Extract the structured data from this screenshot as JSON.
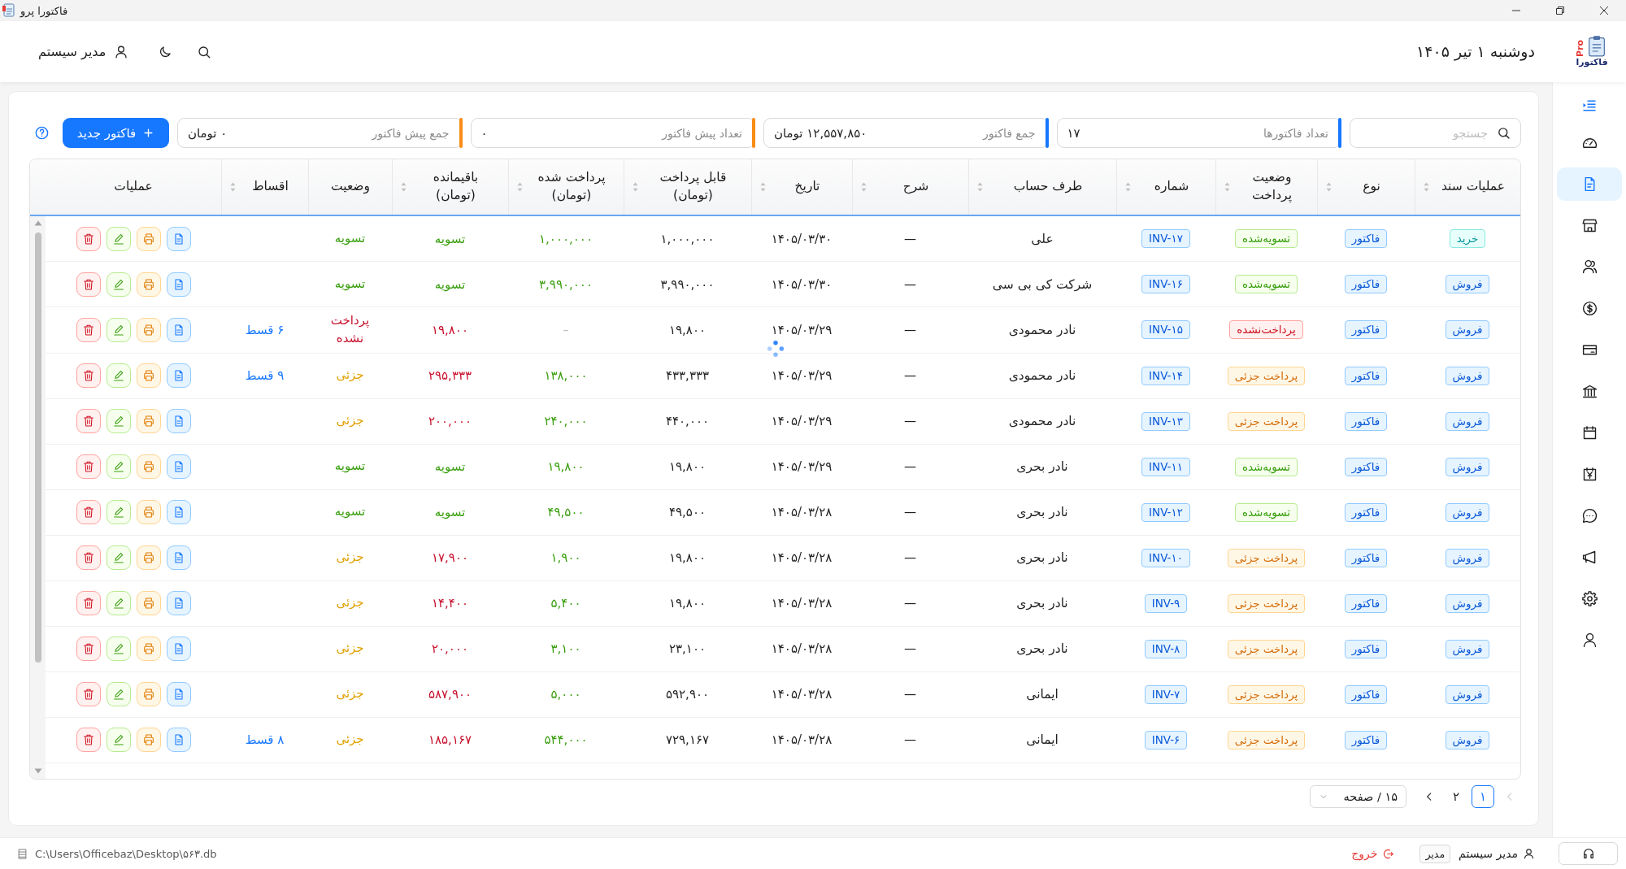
{
  "window": {
    "title": "فاکتورا پرو"
  },
  "header": {
    "logo": {
      "badge": "Pro",
      "name": "فاکتورا"
    },
    "date": "دوشنبه ۱ تیر ۱۴۰۵",
    "user": "مدیر سیستم"
  },
  "sidebar": {
    "items": [
      {
        "kind": "gauge",
        "selected": false
      },
      {
        "kind": "document",
        "selected": true
      },
      {
        "kind": "shop",
        "selected": false
      },
      {
        "kind": "people",
        "selected": false
      },
      {
        "kind": "coin",
        "selected": false
      },
      {
        "kind": "card",
        "selected": false
      },
      {
        "kind": "bank",
        "selected": false
      },
      {
        "kind": "calendar",
        "selected": false
      },
      {
        "kind": "yen",
        "selected": false
      },
      {
        "kind": "chat",
        "selected": false
      },
      {
        "kind": "megaphone",
        "selected": false
      },
      {
        "kind": "gear",
        "selected": false
      },
      {
        "kind": "user",
        "selected": false
      }
    ]
  },
  "toolbar": {
    "search": {
      "placeholder": "جستجو"
    },
    "stats": [
      {
        "label": "تعداد فاکتورها",
        "value": "۱۷",
        "color": "#1677ff"
      },
      {
        "label": "جمع فاکتور",
        "value": "۱۲,۵۵۷,۸۵۰ تومان",
        "color": "#1677ff"
      },
      {
        "label": "تعداد پیش فاکتور",
        "value": "۰",
        "color": "#fa8c16"
      },
      {
        "label": "جمع پیش فاکتور",
        "value": "۰ تومان",
        "color": "#fa8c16"
      }
    ],
    "new_button": "فاکتور جدید"
  },
  "table": {
    "loading": true,
    "columns": [
      {
        "label": "عملیات سند",
        "sortable": true
      },
      {
        "label": "نوع",
        "sortable": true
      },
      {
        "label": "وضعیت پرداخت",
        "sortable": true
      },
      {
        "label": "شماره",
        "sortable": true
      },
      {
        "label": "طرف حساب",
        "sortable": true
      },
      {
        "label": "شرح",
        "sortable": true
      },
      {
        "label": "تاریخ",
        "sortable": true
      },
      {
        "label": "قابل پرداخت (تومان)",
        "sortable": true
      },
      {
        "label": "پرداخت شده (تومان)",
        "sortable": true
      },
      {
        "label": "باقیمانده (تومان)",
        "sortable": true
      },
      {
        "label": "وضعیت",
        "sortable": false
      },
      {
        "label": "اقساط",
        "sortable": true
      },
      {
        "label": "عملیات",
        "sortable": false
      }
    ],
    "rows": [
      {
        "operation": {
          "text": "خرید",
          "kind": "purchase"
        },
        "type": "فاکتور",
        "payment": {
          "text": "تسویه‌شده",
          "kind": "paid"
        },
        "number": "INV-۱۷",
        "party": "علی",
        "description": "—",
        "date": "۱۴۰۵/۰۳/۳۰",
        "payable": "۱,۰۰۰,۰۰۰",
        "paid": {
          "text": "۱,۰۰۰,۰۰۰",
          "kind": "paid"
        },
        "remaining": {
          "text": "تسویه",
          "kind": "paid"
        },
        "status": {
          "text": "تسویه",
          "kind": "paid"
        }
      },
      {
        "operation": {
          "text": "فروش",
          "kind": "sale"
        },
        "type": "فاکتور",
        "payment": {
          "text": "تسویه‌شده",
          "kind": "paid"
        },
        "number": "INV-۱۶",
        "party": "شرکت کی بی سی",
        "description": "—",
        "date": "۱۴۰۵/۰۳/۳۰",
        "payable": "۳,۹۹۰,۰۰۰",
        "paid": {
          "text": "۳,۹۹۰,۰۰۰",
          "kind": "paid"
        },
        "remaining": {
          "text": "تسویه",
          "kind": "paid"
        },
        "status": {
          "text": "تسویه",
          "kind": "paid"
        }
      },
      {
        "operation": {
          "text": "فروش",
          "kind": "sale"
        },
        "type": "فاکتور",
        "payment": {
          "text": "پرداخت‌نشده",
          "kind": "unpaid"
        },
        "number": "INV-۱۵",
        "party": "نادر محمودی",
        "description": "—",
        "date": "۱۴۰۵/۰۳/۲۹",
        "payable": "۱۹,۸۰۰",
        "paid": {
          "text": "–",
          "kind": "none"
        },
        "remaining": {
          "text": "۱۹,۸۰۰",
          "kind": "unpaid"
        },
        "status": {
          "text": "پرداخت نشده",
          "kind": "unpaid"
        },
        "installments": "۶ قسط"
      },
      {
        "operation": {
          "text": "فروش",
          "kind": "sale"
        },
        "type": "فاکتور",
        "payment": {
          "text": "پرداخت جزئی",
          "kind": "partial"
        },
        "number": "INV-۱۴",
        "party": "نادر محمودی",
        "description": "—",
        "date": "۱۴۰۵/۰۳/۲۹",
        "payable": "۴۳۳,۳۳۳",
        "paid": {
          "text": "۱۳۸,۰۰۰",
          "kind": "paid"
        },
        "remaining": {
          "text": "۲۹۵,۳۳۳",
          "kind": "unpaid"
        },
        "status": {
          "text": "جزئی",
          "kind": "partial"
        },
        "installments": "۹ قسط"
      },
      {
        "operation": {
          "text": "فروش",
          "kind": "sale"
        },
        "type": "فاکتور",
        "payment": {
          "text": "پرداخت جزئی",
          "kind": "partial"
        },
        "number": "INV-۱۳",
        "party": "نادر محمودی",
        "description": "—",
        "date": "۱۴۰۵/۰۳/۲۹",
        "payable": "۴۴۰,۰۰۰",
        "paid": {
          "text": "۲۴۰,۰۰۰",
          "kind": "paid"
        },
        "remaining": {
          "text": "۲۰۰,۰۰۰",
          "kind": "unpaid"
        },
        "status": {
          "text": "جزئی",
          "kind": "partial"
        }
      },
      {
        "operation": {
          "text": "فروش",
          "kind": "sale"
        },
        "type": "فاکتور",
        "payment": {
          "text": "تسویه‌شده",
          "kind": "paid"
        },
        "number": "INV-۱۱",
        "party": "نادر بحری",
        "description": "—",
        "date": "۱۴۰۵/۰۳/۲۹",
        "payable": "۱۹,۸۰۰",
        "paid": {
          "text": "۱۹,۸۰۰",
          "kind": "paid"
        },
        "remaining": {
          "text": "تسویه",
          "kind": "paid"
        },
        "status": {
          "text": "تسویه",
          "kind": "paid"
        }
      },
      {
        "operation": {
          "text": "فروش",
          "kind": "sale"
        },
        "type": "فاکتور",
        "payment": {
          "text": "تسویه‌شده",
          "kind": "paid"
        },
        "number": "INV-۱۲",
        "party": "نادر بحری",
        "description": "—",
        "date": "۱۴۰۵/۰۳/۲۸",
        "payable": "۴۹,۵۰۰",
        "paid": {
          "text": "۴۹,۵۰۰",
          "kind": "paid"
        },
        "remaining": {
          "text": "تسویه",
          "kind": "paid"
        },
        "status": {
          "text": "تسویه",
          "kind": "paid"
        }
      },
      {
        "operation": {
          "text": "فروش",
          "kind": "sale"
        },
        "type": "فاکتور",
        "payment": {
          "text": "پرداخت جزئی",
          "kind": "partial"
        },
        "number": "INV-۱۰",
        "party": "نادر بحری",
        "description": "—",
        "date": "۱۴۰۵/۰۳/۲۸",
        "payable": "۱۹,۸۰۰",
        "paid": {
          "text": "۱,۹۰۰",
          "kind": "paid"
        },
        "remaining": {
          "text": "۱۷,۹۰۰",
          "kind": "unpaid"
        },
        "status": {
          "text": "جزئی",
          "kind": "partial"
        }
      },
      {
        "operation": {
          "text": "فروش",
          "kind": "sale"
        },
        "type": "فاکتور",
        "payment": {
          "text": "پرداخت جزئی",
          "kind": "partial"
        },
        "number": "INV-۹",
        "party": "نادر بحری",
        "description": "—",
        "date": "۱۴۰۵/۰۳/۲۸",
        "payable": "۱۹,۸۰۰",
        "paid": {
          "text": "۵,۴۰۰",
          "kind": "paid"
        },
        "remaining": {
          "text": "۱۴,۴۰۰",
          "kind": "unpaid"
        },
        "status": {
          "text": "جزئی",
          "kind": "partial"
        }
      },
      {
        "operation": {
          "text": "فروش",
          "kind": "sale"
        },
        "type": "فاکتور",
        "payment": {
          "text": "پرداخت جزئی",
          "kind": "partial"
        },
        "number": "INV-۸",
        "party": "نادر بحری",
        "description": "—",
        "date": "۱۴۰۵/۰۳/۲۸",
        "payable": "۲۳,۱۰۰",
        "paid": {
          "text": "۳,۱۰۰",
          "kind": "paid"
        },
        "remaining": {
          "text": "۲۰,۰۰۰",
          "kind": "unpaid"
        },
        "status": {
          "text": "جزئی",
          "kind": "partial"
        }
      },
      {
        "operation": {
          "text": "فروش",
          "kind": "sale"
        },
        "type": "فاکتور",
        "payment": {
          "text": "پرداخت جزئی",
          "kind": "partial"
        },
        "number": "INV-۷",
        "party": "ایمانی",
        "description": "—",
        "date": "۱۴۰۵/۰۳/۲۸",
        "payable": "۵۹۲,۹۰۰",
        "paid": {
          "text": "۵,۰۰۰",
          "kind": "paid"
        },
        "remaining": {
          "text": "۵۸۷,۹۰۰",
          "kind": "unpaid"
        },
        "status": {
          "text": "جزئی",
          "kind": "partial"
        }
      },
      {
        "operation": {
          "text": "فروش",
          "kind": "sale"
        },
        "type": "فاکتور",
        "payment": {
          "text": "پرداخت جزئی",
          "kind": "partial"
        },
        "number": "INV-۶",
        "party": "ایمانی",
        "description": "—",
        "date": "۱۴۰۵/۰۳/۲۸",
        "payable": "۷۲۹,۱۶۷",
        "paid": {
          "text": "۵۴۴,۰۰۰",
          "kind": "paid"
        },
        "remaining": {
          "text": "۱۸۵,۱۶۷",
          "kind": "unpaid"
        },
        "status": {
          "text": "جزئی",
          "kind": "partial"
        },
        "installments": "۸ قسط"
      }
    ]
  },
  "pagination": {
    "prev": {
      "disabled": true
    },
    "pages": [
      {
        "label": "۱",
        "selected": true
      },
      {
        "label": "۲",
        "selected": false
      }
    ],
    "next": {
      "disabled": false
    },
    "page_size": "۱۵ / صفحه"
  },
  "status_bar": {
    "db_path": "C:\\Users\\Officebaz\\Desktop\\۵۶۳.db",
    "user": "مدیر سیستم",
    "role": "مدیر",
    "logout": "خروج"
  }
}
